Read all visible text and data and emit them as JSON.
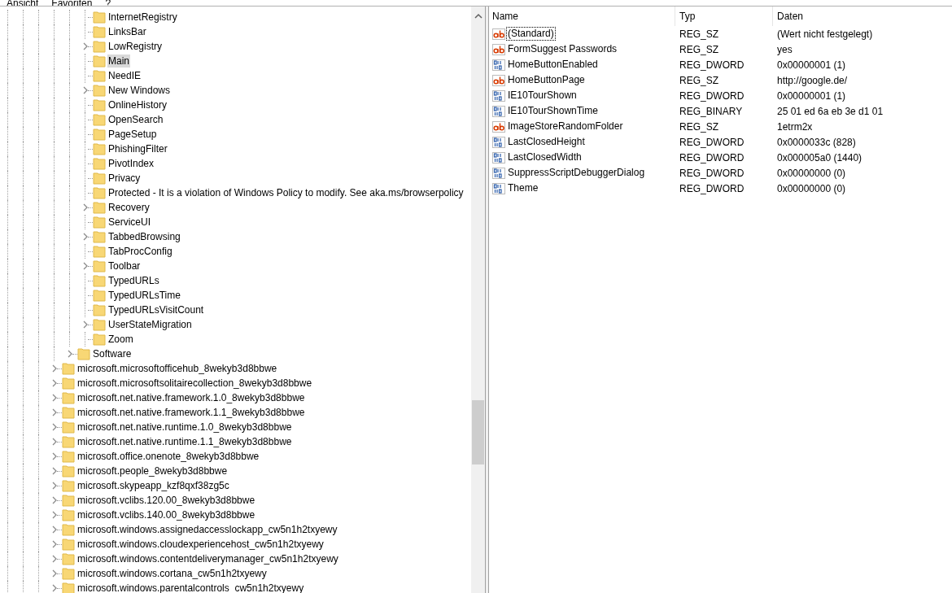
{
  "menu": [
    "Ansicht",
    "Favoriten",
    "?"
  ],
  "tree": {
    "items": [
      {
        "children": [
          {
            "children": [
              {
                "label": "InternetRegistry",
                "expandable": false,
                "selected": false
              },
              {
                "label": "LinksBar",
                "expandable": false,
                "selected": false
              },
              {
                "label": "LowRegistry",
                "expandable": true,
                "selected": false
              },
              {
                "label": "Main",
                "expandable": false,
                "selected": true
              },
              {
                "label": "NeedIE",
                "expandable": false,
                "selected": false
              },
              {
                "label": "New Windows",
                "expandable": true,
                "selected": false
              },
              {
                "label": "OnlineHistory",
                "expandable": false,
                "selected": false
              },
              {
                "label": "OpenSearch",
                "expandable": false,
                "selected": false
              },
              {
                "label": "PageSetup",
                "expandable": false,
                "selected": false
              },
              {
                "label": "PhishingFilter",
                "expandable": false,
                "selected": false
              },
              {
                "label": "PivotIndex",
                "expandable": false,
                "selected": false
              },
              {
                "label": "Privacy",
                "expandable": false,
                "selected": false
              },
              {
                "label": "Protected - It is a violation of Windows Policy to modify. See aka.ms/browserpolicy",
                "expandable": false,
                "selected": false
              },
              {
                "label": "Recovery",
                "expandable": true,
                "selected": false
              },
              {
                "label": "ServiceUI",
                "expandable": false,
                "selected": false
              },
              {
                "label": "TabbedBrowsing",
                "expandable": true,
                "selected": false
              },
              {
                "label": "TabProcConfig",
                "expandable": false,
                "selected": false
              },
              {
                "label": "Toolbar",
                "expandable": true,
                "selected": false
              },
              {
                "label": "TypedURLs",
                "expandable": false,
                "selected": false
              },
              {
                "label": "TypedURLsTime",
                "expandable": false,
                "selected": false
              },
              {
                "label": "TypedURLsVisitCount",
                "expandable": false,
                "selected": false
              },
              {
                "label": "UserStateMigration",
                "expandable": true,
                "selected": false
              },
              {
                "label": "Zoom",
                "expandable": false,
                "selected": false
              }
            ]
          },
          {
            "label": "Software",
            "expandable": true,
            "selected": false
          }
        ]
      },
      {
        "label": "microsoft.microsoftofficehub_8wekyb3d8bbwe",
        "expandable": true,
        "selected": false
      },
      {
        "label": "microsoft.microsoftsolitairecollection_8wekyb3d8bbwe",
        "expandable": true,
        "selected": false
      },
      {
        "label": "microsoft.net.native.framework.1.0_8wekyb3d8bbwe",
        "expandable": true,
        "selected": false
      },
      {
        "label": "microsoft.net.native.framework.1.1_8wekyb3d8bbwe",
        "expandable": true,
        "selected": false
      },
      {
        "label": "microsoft.net.native.runtime.1.0_8wekyb3d8bbwe",
        "expandable": true,
        "selected": false
      },
      {
        "label": "microsoft.net.native.runtime.1.1_8wekyb3d8bbwe",
        "expandable": true,
        "selected": false
      },
      {
        "label": "microsoft.office.onenote_8wekyb3d8bbwe",
        "expandable": true,
        "selected": false
      },
      {
        "label": "microsoft.people_8wekyb3d8bbwe",
        "expandable": true,
        "selected": false
      },
      {
        "label": "microsoft.skypeapp_kzf8qxf38zg5c",
        "expandable": true,
        "selected": false
      },
      {
        "label": "microsoft.vclibs.120.00_8wekyb3d8bbwe",
        "expandable": true,
        "selected": false
      },
      {
        "label": "microsoft.vclibs.140.00_8wekyb3d8bbwe",
        "expandable": true,
        "selected": false
      },
      {
        "label": "microsoft.windows.assignedaccesslockapp_cw5n1h2txyewy",
        "expandable": true,
        "selected": false
      },
      {
        "label": "microsoft.windows.cloudexperiencehost_cw5n1h2txyewy",
        "expandable": true,
        "selected": false
      },
      {
        "label": "microsoft.windows.contentdeliverymanager_cw5n1h2txyewy",
        "expandable": true,
        "selected": false
      },
      {
        "label": "microsoft.windows.cortana_cw5n1h2txyewy",
        "expandable": true,
        "selected": false
      },
      {
        "label": "microsoft.windows.parentalcontrols_cw5n1h2txyewy",
        "expandable": true,
        "selected": false
      }
    ]
  },
  "values": {
    "columns": [
      "Name",
      "Typ",
      "Daten"
    ],
    "rows": [
      {
        "kind": "string",
        "name": "(Standard)",
        "type": "REG_SZ",
        "data": "(Wert nicht festgelegt)",
        "focused": true
      },
      {
        "kind": "string",
        "name": "FormSuggest Passwords",
        "type": "REG_SZ",
        "data": "yes",
        "focused": false
      },
      {
        "kind": "binary",
        "name": "HomeButtonEnabled",
        "type": "REG_DWORD",
        "data": "0x00000001 (1)",
        "focused": false
      },
      {
        "kind": "string",
        "name": "HomeButtonPage",
        "type": "REG_SZ",
        "data": "http://google.de/",
        "focused": false
      },
      {
        "kind": "binary",
        "name": "IE10TourShown",
        "type": "REG_DWORD",
        "data": "0x00000001 (1)",
        "focused": false
      },
      {
        "kind": "binary",
        "name": "IE10TourShownTime",
        "type": "REG_BINARY",
        "data": "25 01 ed 6a eb 3e d1 01",
        "focused": false
      },
      {
        "kind": "string",
        "name": "ImageStoreRandomFolder",
        "type": "REG_SZ",
        "data": "1etrm2x",
        "focused": false
      },
      {
        "kind": "binary",
        "name": "LastClosedHeight",
        "type": "REG_DWORD",
        "data": "0x0000033c (828)",
        "focused": false
      },
      {
        "kind": "binary",
        "name": "LastClosedWidth",
        "type": "REG_DWORD",
        "data": "0x000005a0 (1440)",
        "focused": false
      },
      {
        "kind": "binary",
        "name": "SuppressScriptDebuggerDialog",
        "type": "REG_DWORD",
        "data": "0x00000000 (0)",
        "focused": false
      },
      {
        "kind": "binary",
        "name": "Theme",
        "type": "REG_DWORD",
        "data": "0x00000000 (0)",
        "focused": false
      }
    ]
  }
}
